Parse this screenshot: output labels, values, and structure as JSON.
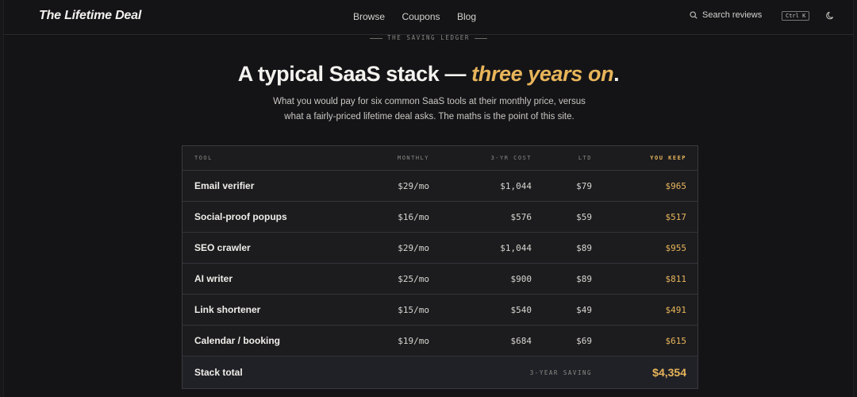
{
  "site": {
    "logo": "The Lifetime Deal"
  },
  "nav": {
    "items": [
      "Browse",
      "Coupons",
      "Blog"
    ]
  },
  "search": {
    "label": "Search reviews",
    "shortcut": "Ctrl K",
    "icon": "search-icon"
  },
  "theme_toggle": {
    "icon": "moon-icon"
  },
  "hero": {
    "eyebrow": "THE SAVING LEDGER",
    "headline_main": "A typical SaaS stack — ",
    "headline_accent": "three years on",
    "headline_end": ".",
    "subtitle": "What you would pay for six common SaaS tools at their monthly price, versus what a fairly-priced lifetime deal asks. The maths is the point of this site."
  },
  "table": {
    "columns": {
      "tool": "TOOL",
      "monthly": "MONTHLY",
      "cost": "3-YR COST",
      "ltd": "LTD",
      "keep": "YOU KEEP"
    },
    "rows": [
      {
        "tool": "Email verifier",
        "monthly": "$29/mo",
        "cost": "$1,044",
        "ltd": "$79",
        "keep": "$965"
      },
      {
        "tool": "Social-proof popups",
        "monthly": "$16/mo",
        "cost": "$576",
        "ltd": "$59",
        "keep": "$517"
      },
      {
        "tool": "SEO crawler",
        "monthly": "$29/mo",
        "cost": "$1,044",
        "ltd": "$89",
        "keep": "$955"
      },
      {
        "tool": "AI writer",
        "monthly": "$25/mo",
        "cost": "$900",
        "ltd": "$89",
        "keep": "$811"
      },
      {
        "tool": "Link shortener",
        "monthly": "$15/mo",
        "cost": "$540",
        "ltd": "$49",
        "keep": "$491"
      },
      {
        "tool": "Calendar / booking",
        "monthly": "$19/mo",
        "cost": "$684",
        "ltd": "$69",
        "keep": "$615"
      }
    ],
    "total": {
      "label": "Stack total",
      "saving_label": "3-YEAR SAVING",
      "saving_value": "$4,354"
    }
  },
  "colors": {
    "accent": "#e8b55a",
    "background": "#141417",
    "text": "#f4f2ee"
  }
}
